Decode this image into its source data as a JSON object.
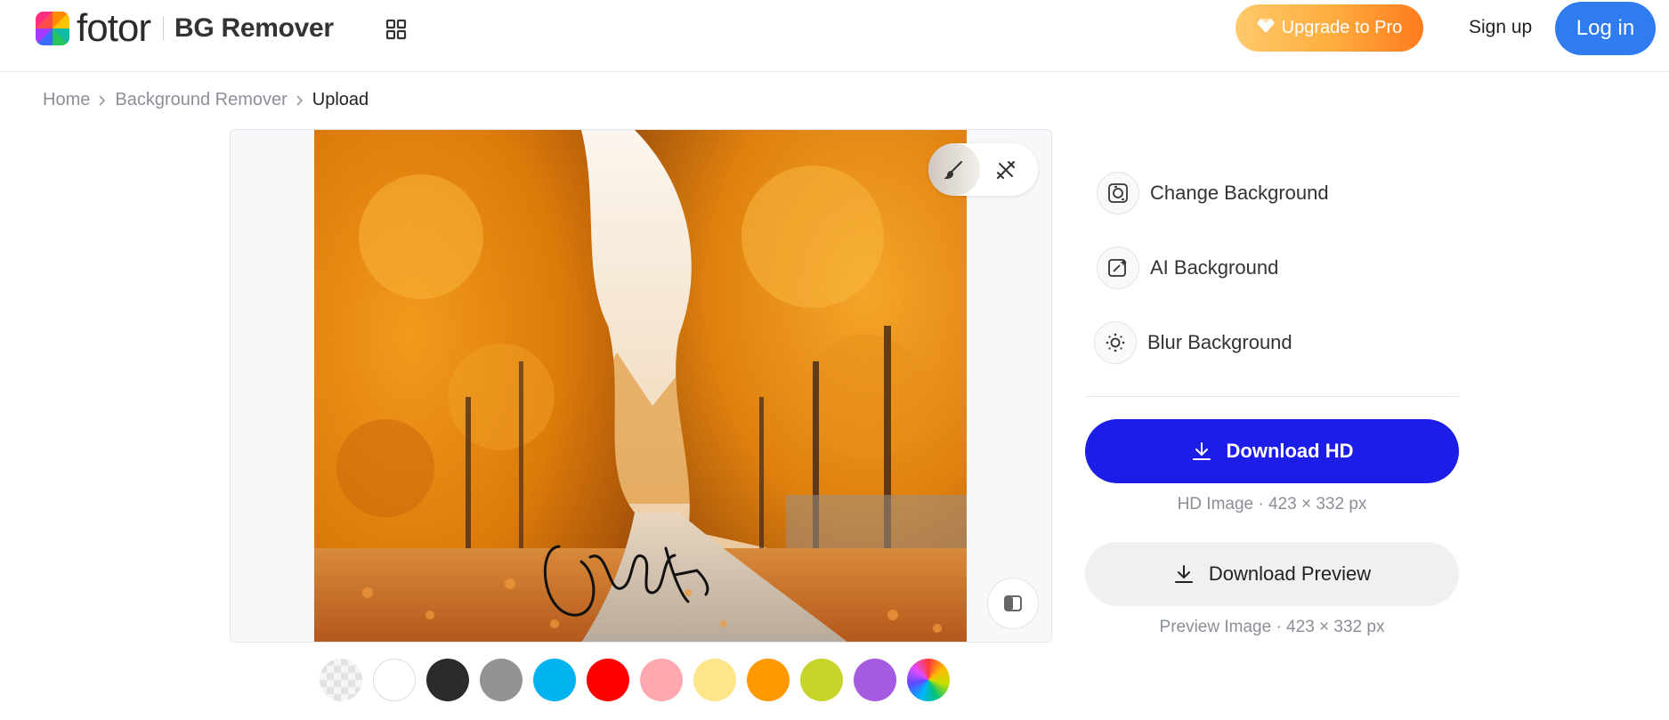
{
  "header": {
    "logo_text": "fotor",
    "product_name": "BG Remover",
    "upgrade_label": "Upgrade to Pro",
    "signup_label": "Sign up",
    "login_label": "Log in",
    "icons": {
      "apps": "grid-apps-icon",
      "upgrade": "diamond-gem-icon"
    },
    "colors": {
      "login": "#2f7bf0",
      "upgrade_start": "#ffc96b",
      "upgrade_end": "#ff7b1e"
    }
  },
  "breadcrumb": {
    "items": [
      "Home",
      "Background Remover",
      "Upload"
    ]
  },
  "editor": {
    "tools": [
      "brush-icon",
      "eraser-restore-icon"
    ],
    "compare_icon": "compare-split-icon"
  },
  "swatches": {
    "colors": [
      "transparent",
      "#ffffff",
      "#2b2b2b",
      "#939393",
      "#00b3ef",
      "#ff0000",
      "#ffa8b0",
      "#ffe58a",
      "#ff9900",
      "#c8d42a",
      "#a55be0",
      "rainbow"
    ]
  },
  "options": [
    {
      "label": "Change Background",
      "icon": "change-background-icon"
    },
    {
      "label": "AI Background",
      "icon": "ai-background-icon"
    },
    {
      "label": "Blur Background",
      "icon": "blur-background-icon"
    }
  ],
  "downloads": {
    "hd_label": "Download HD",
    "hd_info": "HD Image · 423 × 332 px",
    "preview_label": "Download Preview",
    "preview_info": "Preview Image · 423 × 332 px",
    "colors": {
      "hd": "#1d1de8",
      "preview": "#f0f0f0"
    }
  }
}
